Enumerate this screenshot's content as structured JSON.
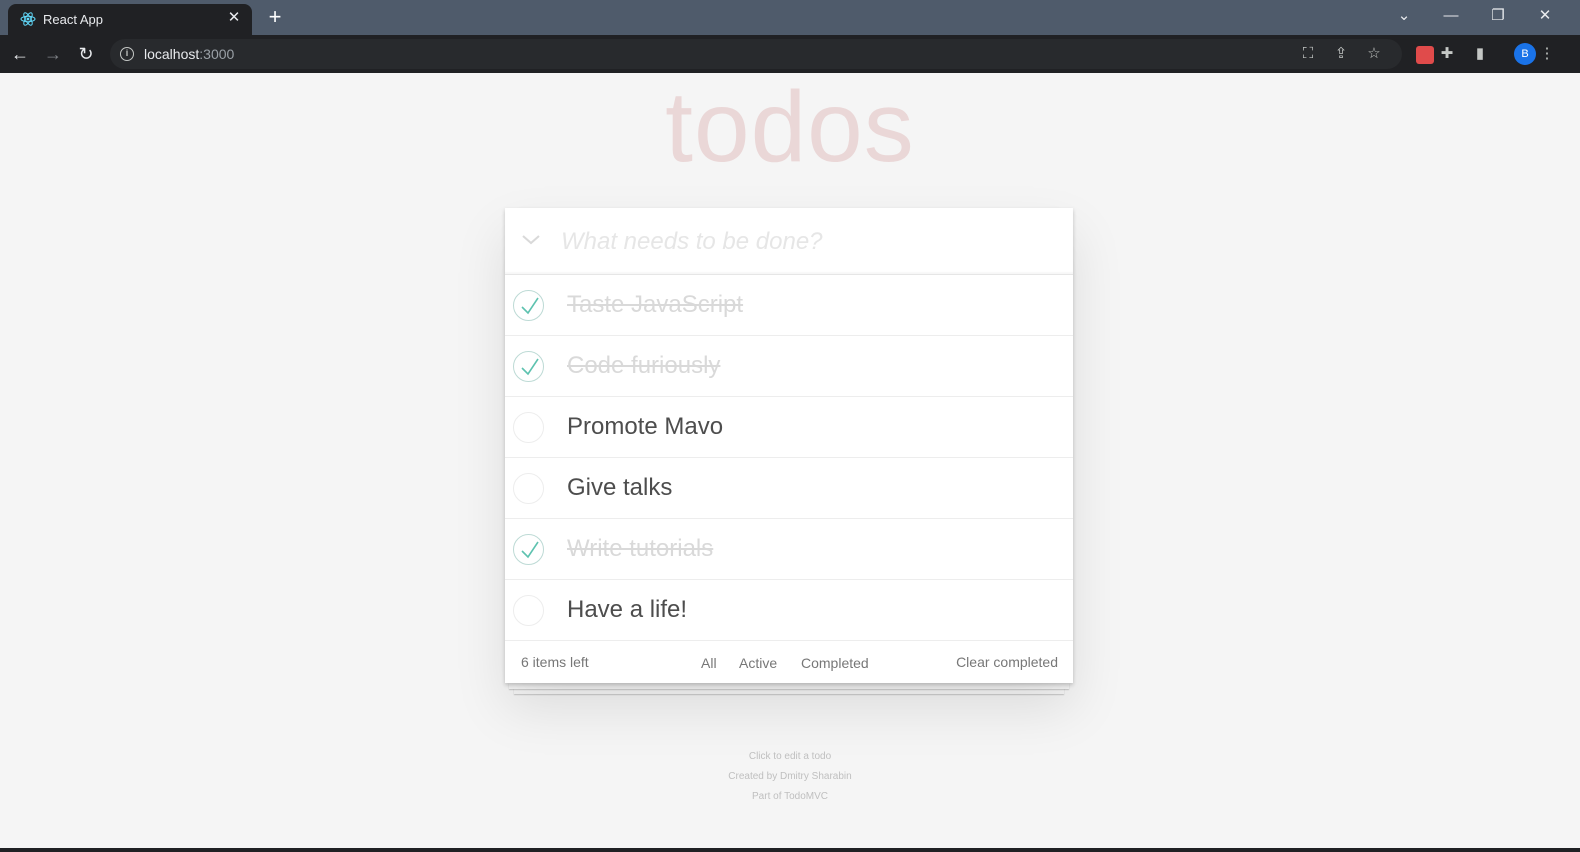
{
  "browser": {
    "tab_title": "React App",
    "new_tab_label": "+",
    "url_host": "localhost",
    "url_port": ":3000",
    "profile_initial": "B"
  },
  "app": {
    "title": "todos",
    "new_todo_placeholder": "What needs to be done?",
    "new_todo_value": "",
    "todos": [
      {
        "label": "Taste JavaScript",
        "completed": true
      },
      {
        "label": "Code furiously",
        "completed": true
      },
      {
        "label": "Promote Mavo",
        "completed": false
      },
      {
        "label": "Give talks",
        "completed": false
      },
      {
        "label": "Write tutorials",
        "completed": true
      },
      {
        "label": "Have a life!",
        "completed": false
      }
    ],
    "footer": {
      "count_text": "6 items left",
      "filters": [
        "All",
        "Active",
        "Completed"
      ],
      "clear_label": "Clear completed"
    },
    "info": [
      "Click to edit a todo",
      "Created by Dmitry Sharabin",
      "Part of TodoMVC"
    ]
  },
  "colors": {
    "title": "#af2f2f",
    "check": "#5dc2af",
    "chrome_tabbar": "#4f5b6b",
    "chrome_toolbar": "#202124"
  }
}
